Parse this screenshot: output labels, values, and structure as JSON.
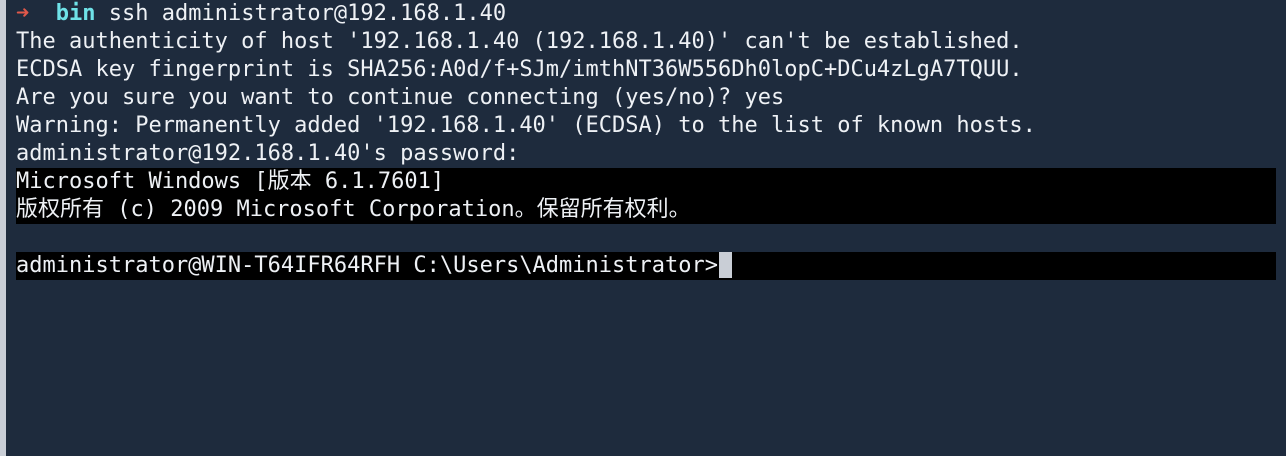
{
  "terminal": {
    "prompt_arrow": "➜",
    "prompt_dir": "bin",
    "command": "ssh administrator@192.168.1.40",
    "lines": [
      "The authenticity of host '192.168.1.40 (192.168.1.40)' can't be established.",
      "ECDSA key fingerprint is SHA256:A0d/f+SJm/imthNT36W556Dh0lopC+DCu4zLgA7TQUU.",
      "Are you sure you want to continue connecting (yes/no)? yes",
      "Warning: Permanently added '192.168.1.40' (ECDSA) to the list of known hosts.",
      "administrator@192.168.1.40's password:"
    ],
    "windows_banner": [
      "Microsoft Windows [版本 6.1.7601]",
      "版权所有 (c) 2009 Microsoft Corporation。保留所有权利。"
    ],
    "windows_prompt": "administrator@WIN-T64IFR64RFH C:\\Users\\Administrator>"
  },
  "colors": {
    "background": "#1e2b3d",
    "text": "#eef1f5",
    "arrow": "#e0584a",
    "dir": "#6fe2e8",
    "remote_background": "#000000",
    "cursor": "#c9ced6"
  },
  "icons": {
    "prompt_arrow": "arrow-right-icon",
    "cursor": "block-cursor"
  }
}
